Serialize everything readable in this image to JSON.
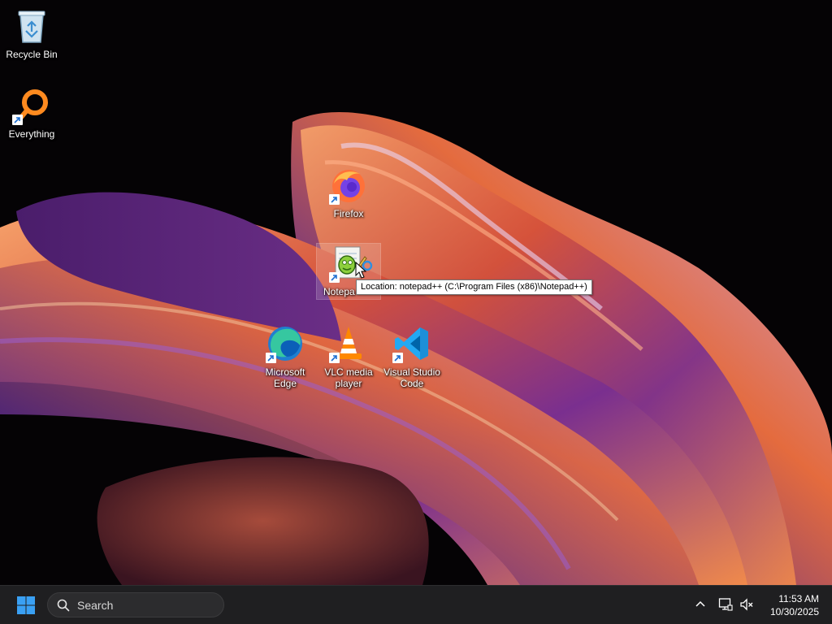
{
  "desktop": {
    "icons": [
      {
        "label": "Recycle Bin",
        "icon": "recycle-bin-icon"
      },
      {
        "label": "Everything",
        "icon": "everything-search-icon"
      },
      {
        "label": "Firefox",
        "icon": "firefox-icon"
      },
      {
        "label": "Notepad++",
        "icon": "notepad-plus-plus-icon"
      },
      {
        "label": "Microsoft Edge",
        "icon": "edge-icon"
      },
      {
        "label": "VLC media player",
        "icon": "vlc-icon"
      },
      {
        "label": "Visual Studio Code",
        "icon": "vscode-icon"
      }
    ],
    "notepad_visible_label": "Notepa",
    "tooltip": "Location: notepad++ (C:\\Program Files (x86)\\Notepad++)"
  },
  "taskbar": {
    "search_placeholder": "Search",
    "clock": {
      "time": "11:53 AM",
      "date": "10/30/2025"
    }
  },
  "colors": {
    "taskbar_bg": "#1f1f21",
    "start_blue": "#3aa0f3",
    "firefox_orange": "#ff7139",
    "vscode_blue": "#23a9f2",
    "vlc_orange": "#ff8800",
    "edge_teal": "#36c7a0"
  }
}
